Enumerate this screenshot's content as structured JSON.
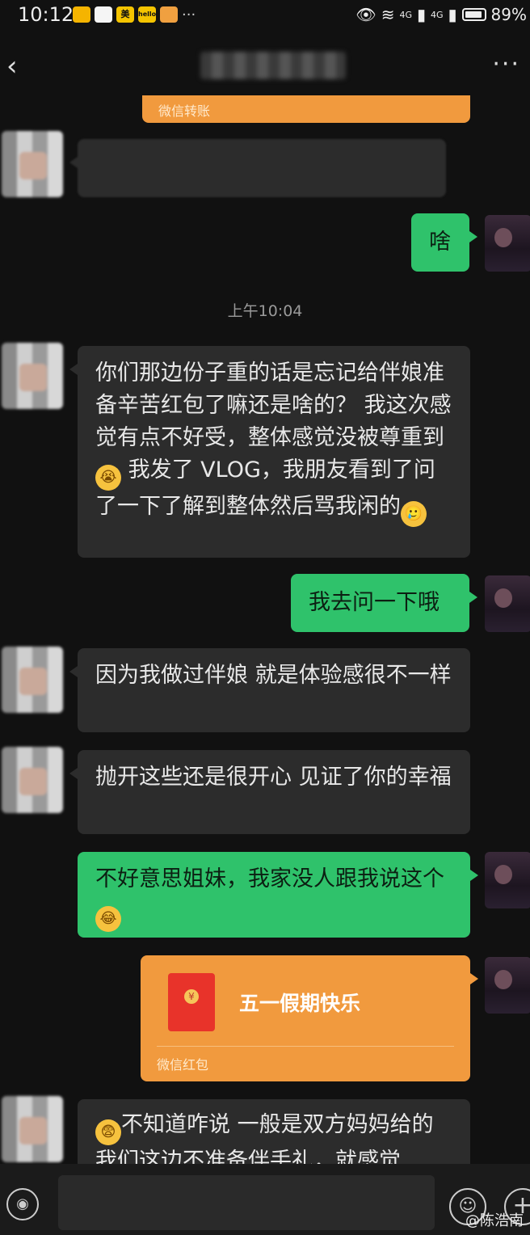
{
  "status_bar": {
    "time": "10:12",
    "apps": [
      "美",
      "hello",
      ""
    ],
    "signal_1": "4G",
    "signal_2": "4G",
    "battery": "89%",
    "battery_level": 0.89
  },
  "nav": {
    "back_icon": "chevron-left-icon",
    "more_icon": "more-dots-icon"
  },
  "transfer_label": "微信转账",
  "timestamp": "上午10:04",
  "messages": [
    {
      "side": "left",
      "text": ""
    },
    {
      "side": "right",
      "text": "啥"
    },
    {
      "side": "left",
      "text": "你们那边份子重的话是忘记给伴娘准备辛苦红包了嘛还是啥的？ 我这次感觉有点不好受，整体感觉没被尊重到",
      "text_after": " 我发了 VLOG，我朋友看到了问了一下了解到整体然后骂我闲的"
    },
    {
      "side": "right",
      "text": "我去问一下哦"
    },
    {
      "side": "left",
      "text": "因为我做过伴娘 就是体验感很不一样"
    },
    {
      "side": "left",
      "text": "抛开这些还是很开心 见证了你的幸福"
    },
    {
      "side": "right",
      "text": "不好意思姐妹，我家没人跟我说这个"
    },
    {
      "side": "left",
      "text": "不知道咋说 一般是双方妈妈给的 我们这边不准备伴手礼，就感觉"
    }
  ],
  "red_packet": {
    "title": "五一假期快乐",
    "label": "微信红包"
  },
  "watermark": "@陈浩南",
  "colors": {
    "bg": "#111111",
    "bubble_left": "#2c2c2c",
    "bubble_right": "#2fc26b",
    "orange": "#f19a3e"
  }
}
